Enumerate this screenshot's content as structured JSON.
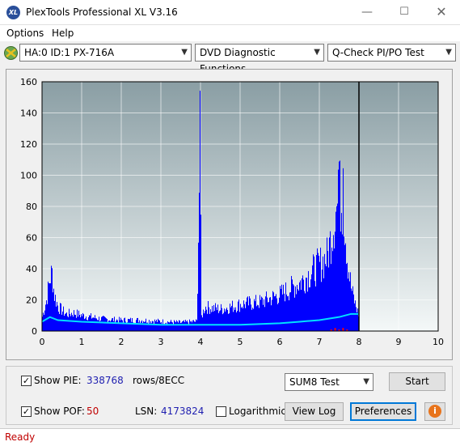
{
  "window": {
    "title": "PlexTools Professional XL V3.16",
    "icon_label": "XL"
  },
  "menu": [
    {
      "label": "Options"
    },
    {
      "label": "Help"
    }
  ],
  "toolbar": {
    "drive_select": "HA:0 ID:1  PX-716A",
    "function_select": "DVD Diagnostic Functions",
    "test_select": "Q-Check PI/PO Test"
  },
  "colors": {
    "plot_bg_top": "#8a9ea4",
    "plot_bg_bottom": "#f4f8f8",
    "pie_bars": "#0000ff",
    "pie_avg_line": "#00e0ff",
    "pof": "#ff0000",
    "status_text": "#c00000"
  },
  "chart_data": {
    "type": "bar",
    "x_ticks": [
      "0",
      "1",
      "2",
      "3",
      "4",
      "5",
      "6",
      "7",
      "8",
      "9",
      "10"
    ],
    "y_ticks": [
      "0",
      "20",
      "40",
      "60",
      "80",
      "100",
      "120",
      "140",
      "160"
    ],
    "xlim": [
      0,
      10
    ],
    "ylim": [
      0,
      160
    ],
    "data_end_x": 8.0,
    "grid": true,
    "series": [
      {
        "name": "PIE",
        "x": [
          0.0,
          0.1,
          0.2,
          0.25,
          0.3,
          0.4,
          0.6,
          0.8,
          1.0,
          1.5,
          2.0,
          2.5,
          3.0,
          3.5,
          3.9,
          3.98,
          4.0,
          4.02,
          4.1,
          4.5,
          5.0,
          5.5,
          6.0,
          6.5,
          7.0,
          7.2,
          7.4,
          7.5,
          7.6,
          7.7,
          7.8,
          7.9,
          8.0
        ],
        "values": [
          12,
          25,
          45,
          48,
          30,
          20,
          14,
          15,
          13,
          10,
          9,
          9,
          8,
          7,
          8,
          155,
          75,
          12,
          20,
          18,
          22,
          24,
          30,
          40,
          55,
          62,
          98,
          110,
          104,
          60,
          35,
          22,
          12
        ]
      },
      {
        "name": "PIE average",
        "x": [
          0.0,
          0.2,
          0.4,
          1.0,
          2.0,
          3.0,
          4.0,
          5.0,
          6.0,
          6.5,
          7.0,
          7.5,
          7.8,
          8.0
        ],
        "values": [
          6,
          9,
          7,
          6,
          5,
          4,
          4,
          4,
          5,
          6,
          7,
          9,
          11,
          11
        ]
      },
      {
        "name": "POF",
        "x": [
          7.3,
          7.4,
          7.5,
          7.6,
          7.7
        ],
        "values": [
          1,
          2,
          1,
          2,
          1
        ]
      }
    ]
  },
  "controls": {
    "show_pie_label": "Show PIE:",
    "pie_value": "338768",
    "pie_unit": "rows/8ECC",
    "show_pof_label": "Show POF:",
    "pof_value": "50",
    "lsn_label": "LSN:",
    "lsn_value": "4173824",
    "logarithmic_label": "Logarithmic",
    "test_mode_select": "SUM8 Test",
    "start_button": "Start",
    "view_log_button": "View Log",
    "preferences_button": "Preferences"
  },
  "status": {
    "text": "Ready"
  }
}
